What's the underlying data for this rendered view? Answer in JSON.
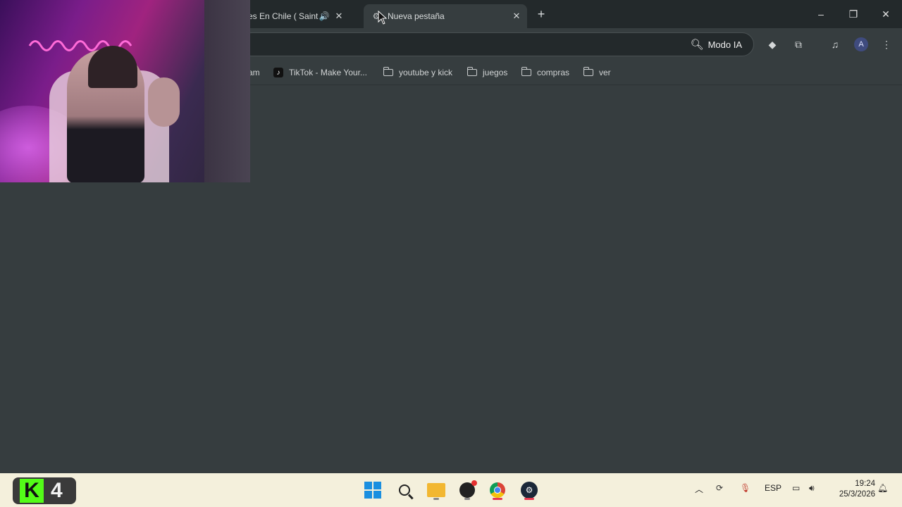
{
  "browser": {
    "tabs": [
      {
        "title": "es En Chile ( Saint",
        "audio_icon": "speaker-icon",
        "active": false
      },
      {
        "title": "Nueva pestaña",
        "active": true
      }
    ],
    "new_tab_symbol": "+",
    "window_controls": {
      "minimize": "–",
      "restore": "❐",
      "close": "✕"
    },
    "omnibox": {
      "value": "",
      "ai_button_label": "Modo IA"
    },
    "profile_initial": "A",
    "bookmarks": [
      {
        "label": "am",
        "type": "partial"
      },
      {
        "label": "TikTok - Make Your...",
        "type": "tiktok"
      },
      {
        "label": "youtube y kick",
        "type": "folder"
      },
      {
        "label": "juegos",
        "type": "folder"
      },
      {
        "label": "compras",
        "type": "folder"
      },
      {
        "label": "ver",
        "type": "folder"
      }
    ]
  },
  "overlay": {
    "kick_letter": "K",
    "kick_count": "4"
  },
  "taskbar": {
    "tray": {
      "language": "ESP"
    },
    "clock": {
      "time": "19:24",
      "date": "25/3/2026"
    }
  },
  "colors": {
    "page_bg": "#363d3f",
    "tabstrip_bg": "#23292b",
    "taskbar_bg": "#f4f0dc",
    "kick_green": "#53fc18"
  }
}
